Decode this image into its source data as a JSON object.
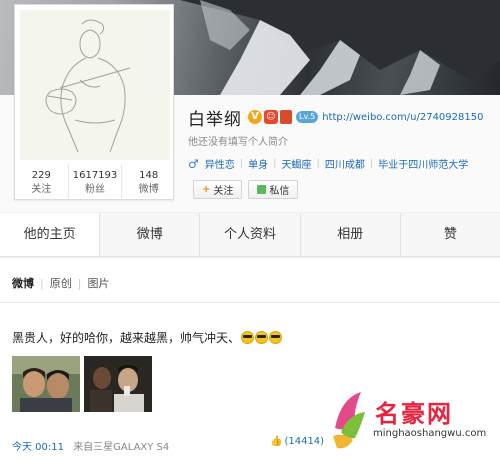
{
  "profile": {
    "name": "白举纲",
    "level_badge": "Lv.5",
    "url": "http://weibo.com/u/2740928150",
    "bio": "他还没有填写个人简介",
    "tags": [
      "异性恋",
      "单身",
      "天蝎座",
      "四川成都",
      "毕业于四川师范大学"
    ],
    "stats": [
      {
        "value": "229",
        "label": "关注"
      },
      {
        "value": "1617193",
        "label": "粉丝"
      },
      {
        "value": "148",
        "label": "微博"
      }
    ],
    "follow_label": "关注",
    "message_label": "私信",
    "colors": {
      "link": "#1a6bb5",
      "follow_plus": "#f08a1a"
    }
  },
  "tabs": [
    {
      "label": "他的主页",
      "active": true
    },
    {
      "label": "微博",
      "active": false
    },
    {
      "label": "个人资料",
      "active": false
    },
    {
      "label": "相册",
      "active": false
    },
    {
      "label": "赞",
      "active": false
    }
  ],
  "feed": {
    "filters": [
      "微博",
      "原创",
      "图片"
    ],
    "post": {
      "text": "黑贵人，好的哈你，越来越黑，帅气冲天、",
      "time": "今天 00:11",
      "source": "来自三星GALAXY S4",
      "likes": "(14414)"
    }
  },
  "watermark": {
    "title": "名豪网",
    "site": "minghaoshangwu.com"
  }
}
